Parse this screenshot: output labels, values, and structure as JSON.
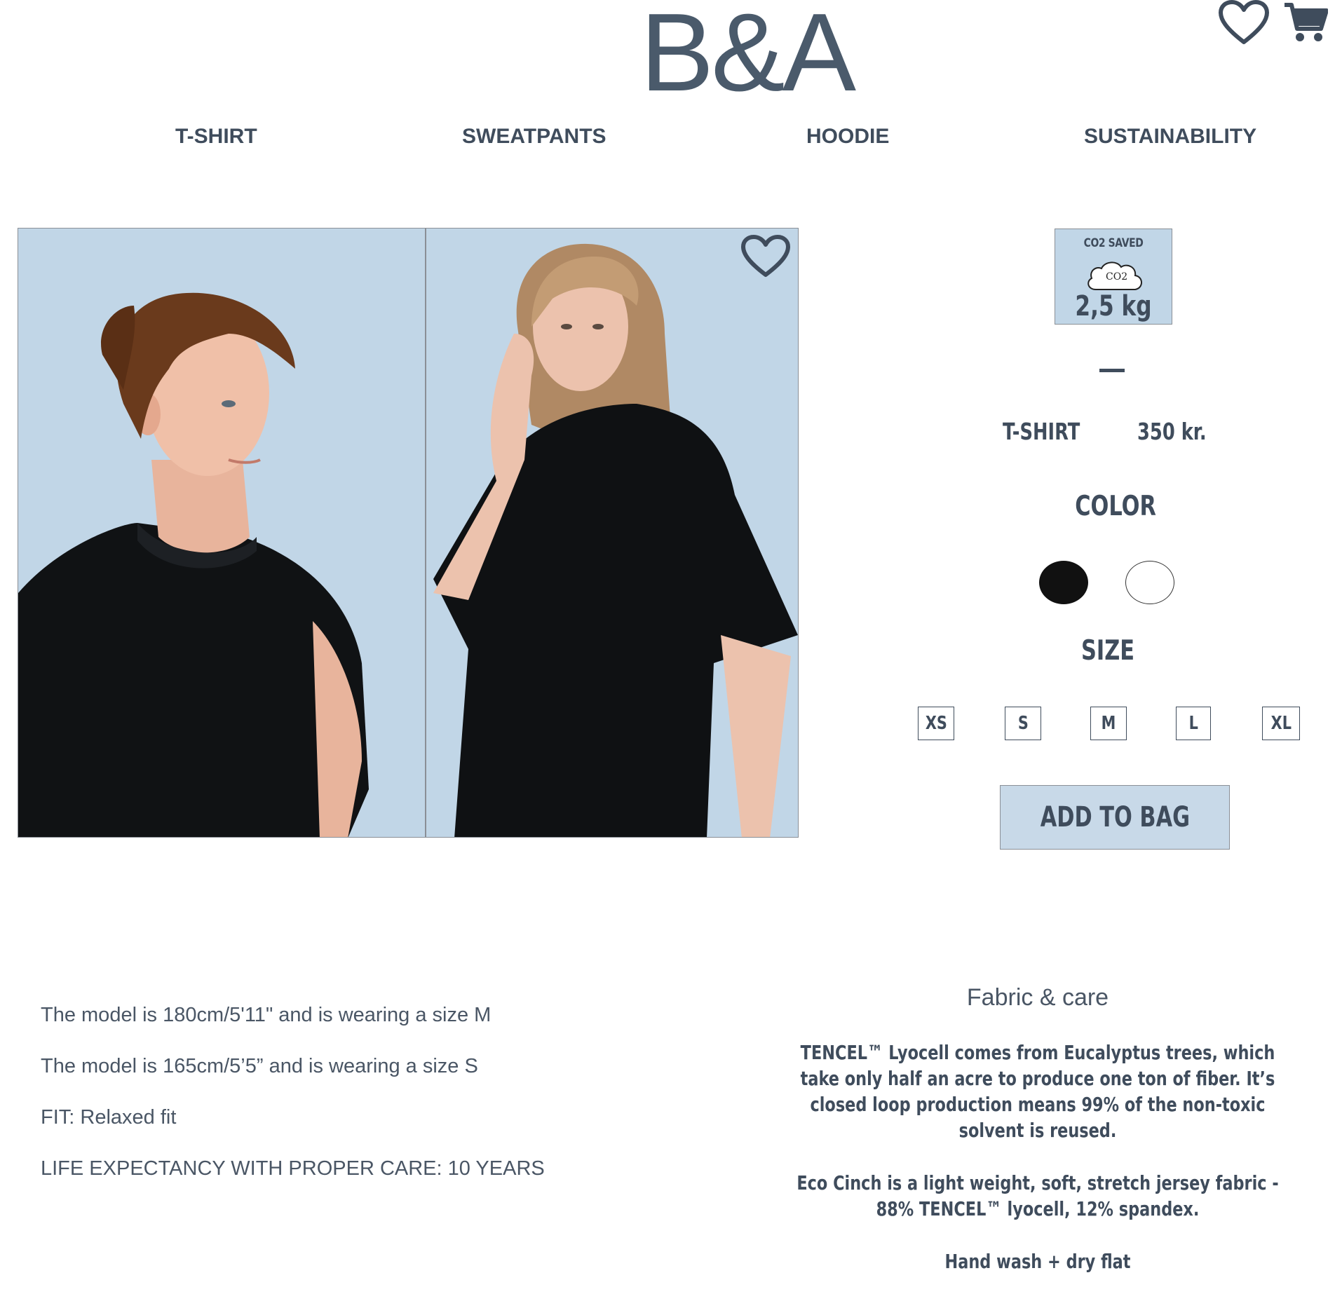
{
  "header": {
    "brand": "B&A",
    "icons": [
      "heart-icon",
      "cart-icon"
    ]
  },
  "nav": {
    "items": [
      {
        "label": "T-SHIRT"
      },
      {
        "label": "SWEATPANTS"
      },
      {
        "label": "HOODIE"
      },
      {
        "label": "SUSTAINABILITY"
      }
    ]
  },
  "gallery": {
    "background_color": "#c1d6e7",
    "favorite_icon": "heart-outline-icon"
  },
  "co2": {
    "title": "CO2 SAVED",
    "cloud_text": "CO2",
    "value": "2,5 kg"
  },
  "product": {
    "name": "T-SHIRT",
    "price": "350 kr."
  },
  "color": {
    "heading": "COLOR",
    "options": [
      {
        "name": "black",
        "hex": "#111111"
      },
      {
        "name": "white",
        "hex": "#ffffff"
      }
    ]
  },
  "size": {
    "heading": "SIZE",
    "options": [
      "XS",
      "S",
      "M",
      "L",
      "XL"
    ]
  },
  "cta": {
    "add_to_bag": "ADD TO BAG"
  },
  "details": {
    "lines": [
      "The model is 180cm/5'11\" and is wearing a size M",
      "The model is 165cm/5’5” and is wearing a size S",
      "FIT:  Relaxed fit",
      "LIFE EXPECTANCY WITH PROPER CARE: 10 YEARS"
    ]
  },
  "fabric": {
    "heading": "Fabric & care",
    "paragraphs": [
      "TENCEL™ Lyocell comes from Eucalyptus trees, which take only half an acre to produce one ton of fiber. It’s closed loop production means 99% of the non-toxic solvent is reused.",
      "Eco Cinch is a light weight, soft, stretch jersey fabric - 88% TENCEL™ lyocell, 12% spandex.",
      "Hand wash + dry flat"
    ]
  },
  "colors": {
    "text": "#3f4c5c",
    "accent_light_blue": "#c1d6e7"
  }
}
